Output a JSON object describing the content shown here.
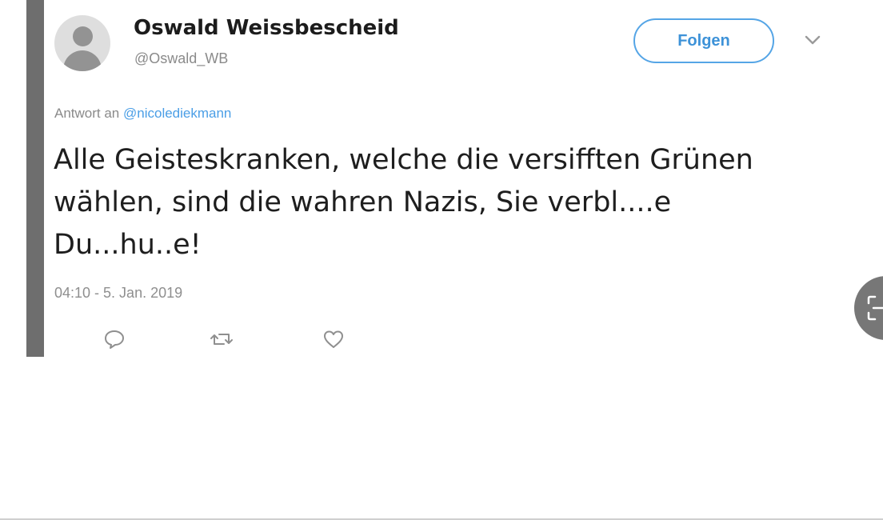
{
  "tweet": {
    "display_name": "Oswald Weissbescheid",
    "handle": "@Oswald_WB",
    "follow_label": "Folgen",
    "reply_prefix": "Antwort an",
    "reply_mention": "@nicolediekmann",
    "text": "Alle Geisteskranken, welche die versifften Grünen wählen, sind die wahren Nazis, Sie verbl....e Du...hu..e!",
    "timestamp": "04:10 - 5. Jan. 2019"
  },
  "icons": {
    "reply": "reply-icon",
    "retweet": "retweet-icon",
    "like": "heart-icon",
    "menu": "chevron-down-icon",
    "scan": "scan-icon"
  },
  "colors": {
    "accent": "#4a9ee6",
    "follow_border": "#55a5e6",
    "text": "#1e1e1e",
    "muted": "#8a8a8a",
    "left_border": "#6e6e6e",
    "fab": "#777777"
  }
}
